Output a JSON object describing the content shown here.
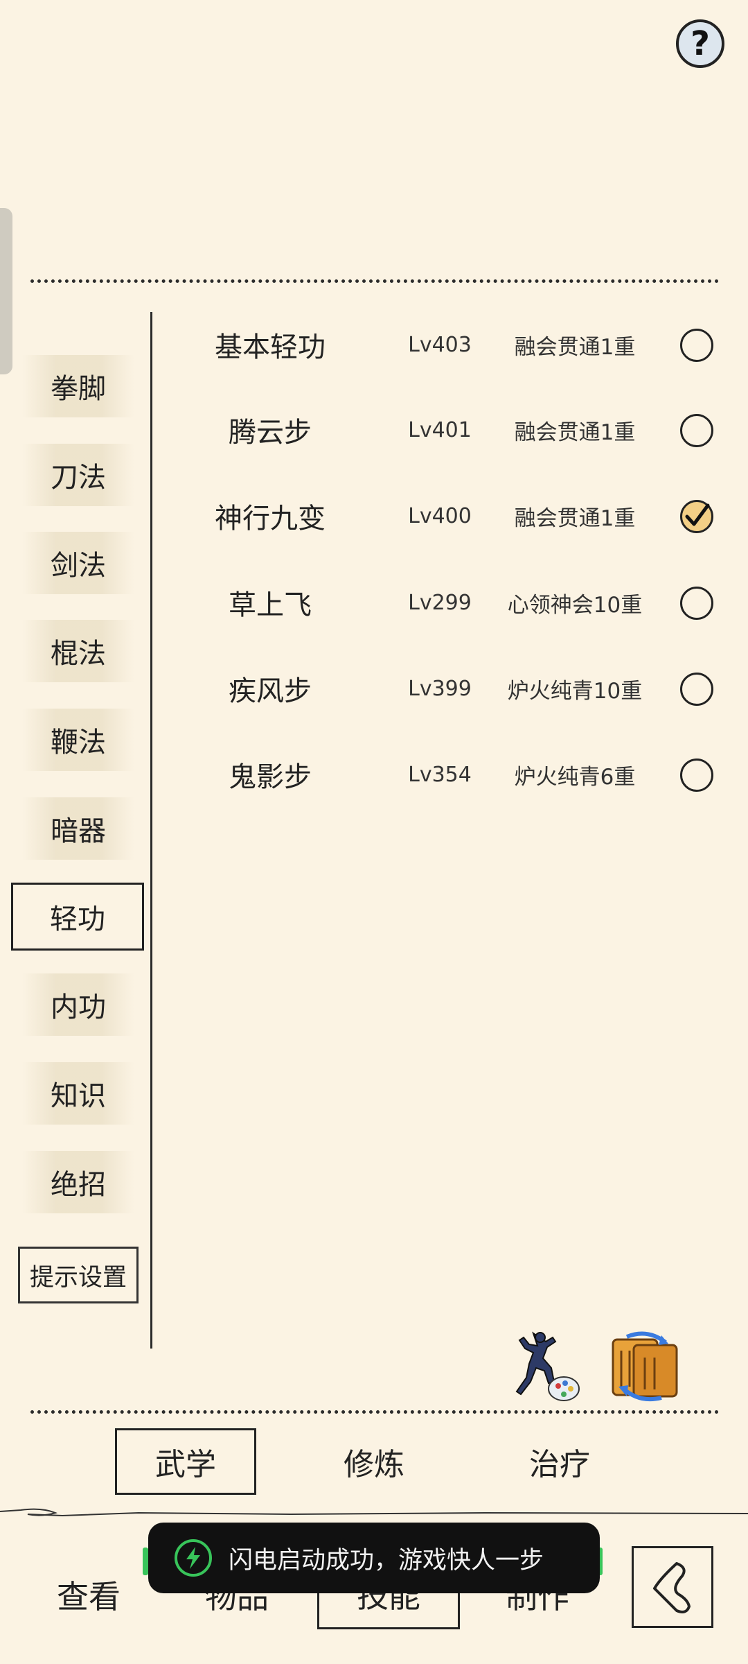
{
  "help_button": {
    "label": "?"
  },
  "categories": [
    {
      "label": "拳脚",
      "active": false
    },
    {
      "label": "刀法",
      "active": false
    },
    {
      "label": "剑法",
      "active": false
    },
    {
      "label": "棍法",
      "active": false
    },
    {
      "label": "鞭法",
      "active": false
    },
    {
      "label": "暗器",
      "active": false
    },
    {
      "label": "轻功",
      "active": true
    },
    {
      "label": "内功",
      "active": false
    },
    {
      "label": "知识",
      "active": false
    },
    {
      "label": "绝招",
      "active": false
    }
  ],
  "tip_settings_label": "提示设置",
  "skills": [
    {
      "name": "基本轻功",
      "level": "Lv403",
      "rank": "融会贯通1重",
      "selected": false
    },
    {
      "name": "腾云步",
      "level": "Lv401",
      "rank": "融会贯通1重",
      "selected": false
    },
    {
      "name": "神行九变",
      "level": "Lv400",
      "rank": "融会贯通1重",
      "selected": true
    },
    {
      "name": "草上飞",
      "level": "Lv299",
      "rank": "心领神会10重",
      "selected": false
    },
    {
      "name": "疾风步",
      "level": "Lv399",
      "rank": "炉火纯青10重",
      "selected": false
    },
    {
      "name": "鬼影步",
      "level": "Lv354",
      "rank": "炉火纯青6重",
      "selected": false
    }
  ],
  "sub_tabs": [
    {
      "label": "武学",
      "active": true
    },
    {
      "label": "修炼",
      "active": false
    },
    {
      "label": "治疗",
      "active": false
    }
  ],
  "bottom_nav": [
    {
      "label": "查看",
      "active": false
    },
    {
      "label": "物品",
      "active": false
    },
    {
      "label": "技能",
      "active": true
    },
    {
      "label": "制作",
      "active": false
    }
  ],
  "toast": {
    "text": "闪电启动成功，游戏快人一步"
  },
  "colors": {
    "background": "#fbf3e3",
    "ink": "#222222",
    "checked_fill": "#f3cf86",
    "toast_bg": "#111111",
    "toast_accent": "#38c45a"
  }
}
